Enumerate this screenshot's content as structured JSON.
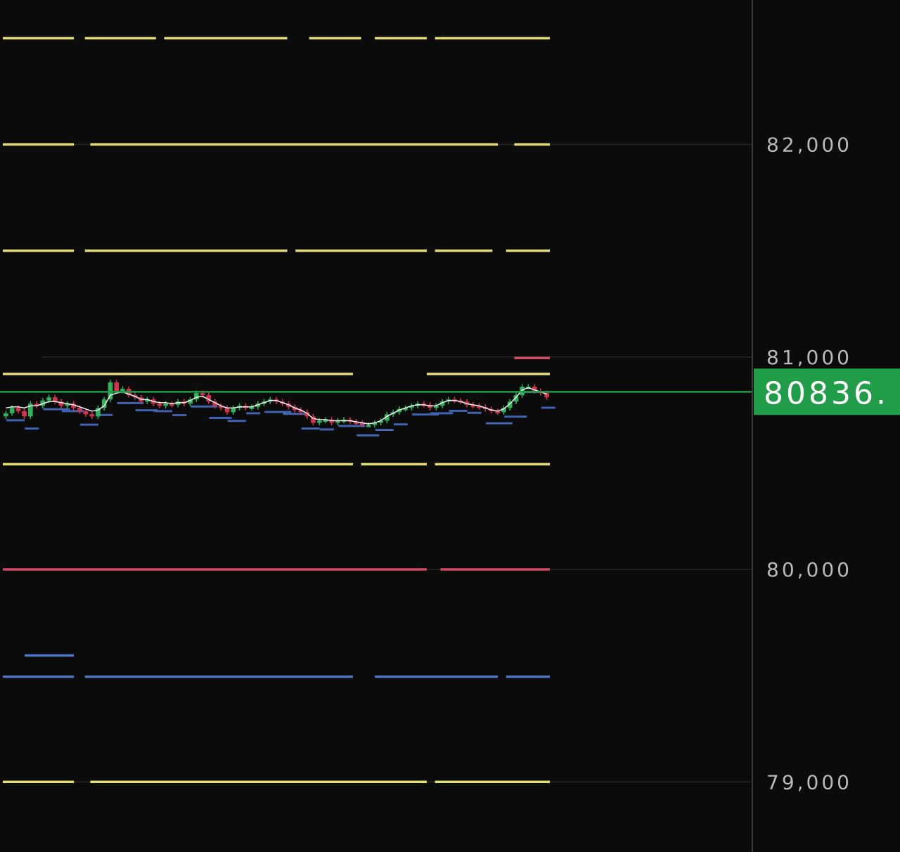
{
  "chart_data": {
    "type": "line",
    "title": "",
    "xlabel": "",
    "ylabel": "",
    "ylim": [
      78670,
      82680
    ],
    "grid": true,
    "y_ticks": [
      {
        "value": 82000,
        "label": "82,000"
      },
      {
        "value": 81000,
        "label": "81,000"
      },
      {
        "value": 80000,
        "label": "80,000"
      },
      {
        "value": 79000,
        "label": "79,000"
      }
    ],
    "current_price": {
      "value": 80836,
      "label": "80836.",
      "color": "#1f9d49"
    },
    "level_lines": [
      {
        "price": 82500,
        "color": "#e6dc78",
        "segments": [
          [
            0.0,
            0.13
          ],
          [
            0.15,
            0.28
          ],
          [
            0.295,
            0.52
          ],
          [
            0.56,
            0.655
          ],
          [
            0.68,
            0.775
          ],
          [
            0.79,
            0.8
          ],
          [
            0.8,
            1.0
          ]
        ]
      },
      {
        "price": 82000,
        "color": "#e6dc78",
        "segments": [
          [
            0.0,
            0.13
          ],
          [
            0.16,
            0.905
          ],
          [
            0.935,
            1.0
          ]
        ]
      },
      {
        "price": 81500,
        "color": "#e6dc78",
        "segments": [
          [
            0.0,
            0.13
          ],
          [
            0.15,
            0.52
          ],
          [
            0.535,
            0.775
          ],
          [
            0.79,
            0.895
          ],
          [
            0.92,
            1.0
          ]
        ]
      },
      {
        "price": 80920,
        "color": "#e6dc78",
        "segments": [
          [
            0.0,
            0.64
          ],
          [
            0.775,
            1.0
          ]
        ]
      },
      {
        "price": 80495,
        "color": "#e6dc78",
        "segments": [
          [
            0.0,
            0.64
          ],
          [
            0.655,
            0.775
          ],
          [
            0.79,
            1.0
          ]
        ]
      },
      {
        "price": 80000,
        "color": "#d24b63",
        "segments": [
          [
            0.0,
            0.775
          ],
          [
            0.8,
            1.0
          ]
        ]
      },
      {
        "price": 79595,
        "color": "#4a74c4",
        "segments": [
          [
            0.04,
            0.13
          ]
        ]
      },
      {
        "price": 79495,
        "color": "#4a74c4",
        "segments": [
          [
            0.0,
            0.13
          ],
          [
            0.15,
            0.64
          ],
          [
            0.68,
            0.905
          ],
          [
            0.92,
            1.0
          ]
        ]
      },
      {
        "price": 79000,
        "color": "#e6dc78",
        "segments": [
          [
            0.0,
            0.13
          ],
          [
            0.16,
            0.775
          ],
          [
            0.79,
            1.0
          ]
        ]
      },
      {
        "price": 80995,
        "color": "#d24b63",
        "segments": [
          [
            0.935,
            1.0
          ]
        ]
      }
    ],
    "series": [
      {
        "type": "candlestick",
        "up_color": "#2fb35a",
        "down_color": "#d8324a",
        "close": [
          80735,
          80760,
          80745,
          80720,
          80780,
          80770,
          80795,
          80810,
          80790,
          80770,
          80780,
          80760,
          80745,
          80730,
          80720,
          80760,
          80800,
          80880,
          80840,
          80850,
          80820,
          80810,
          80790,
          80800,
          80780,
          80770,
          80780,
          80775,
          80790,
          80780,
          80800,
          80830,
          80820,
          80790,
          80770,
          80760,
          80740,
          80760,
          80770,
          80760,
          80765,
          80780,
          80790,
          80800,
          80790,
          80780,
          80765,
          80750,
          80740,
          80720,
          80690,
          80700,
          80705,
          80690,
          80700,
          80705,
          80695,
          80690,
          80680,
          80680,
          80690,
          80700,
          80730,
          80740,
          80755,
          80760,
          80770,
          80780,
          80775,
          80760,
          80770,
          80790,
          80800,
          80795,
          80790,
          80775,
          80770,
          80765,
          80755,
          80745,
          80740,
          80760,
          80790,
          80820,
          80860,
          80860,
          80840,
          80830,
          80810
        ]
      },
      {
        "type": "line",
        "color": "#ffffff",
        "values": [
          80760,
          80765,
          80765,
          80760,
          80770,
          80770,
          80780,
          80790,
          80790,
          80785,
          80780,
          80775,
          80765,
          80755,
          80745,
          80750,
          80770,
          80820,
          80830,
          80835,
          80825,
          80815,
          80800,
          80800,
          80790,
          80785,
          80785,
          80780,
          80785,
          80785,
          80795,
          80810,
          80815,
          80800,
          80785,
          80770,
          80760,
          80760,
          80765,
          80765,
          80765,
          80775,
          80785,
          80795,
          80795,
          80785,
          80775,
          80760,
          80750,
          80735,
          80710,
          80705,
          80705,
          80700,
          80700,
          80700,
          80700,
          80695,
          80690,
          80685,
          80690,
          80700,
          80720,
          80735,
          80750,
          80760,
          80770,
          80775,
          80775,
          80770,
          80770,
          80785,
          80795,
          80795,
          80790,
          80780,
          80775,
          80770,
          80760,
          80750,
          80745,
          80755,
          80780,
          80810,
          80845,
          80855,
          80845,
          80835,
          80825
        ]
      }
    ]
  }
}
